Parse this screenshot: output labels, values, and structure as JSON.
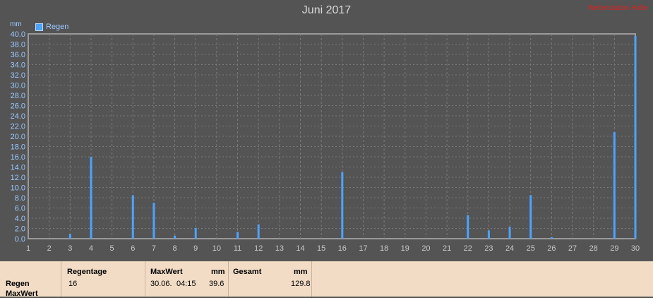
{
  "title": "Juni 2017",
  "watermark": "Wetterstation Halle",
  "legend": {
    "label": "Regen",
    "color": "#4da3ff"
  },
  "unit_label": "mm",
  "chart_data": {
    "type": "bar",
    "title": "Juni 2017",
    "ylabel": "mm",
    "xlabel": "",
    "x_ticks": [
      1,
      2,
      3,
      4,
      5,
      6,
      7,
      8,
      9,
      10,
      11,
      12,
      13,
      14,
      15,
      16,
      17,
      18,
      19,
      20,
      21,
      22,
      23,
      24,
      25,
      26,
      27,
      28,
      29,
      30
    ],
    "y_ticks": [
      "0.0",
      "2.0",
      "4.0",
      "6.0",
      "8.0",
      "10.0",
      "12.0",
      "14.0",
      "16.0",
      "18.0",
      "20.0",
      "22.0",
      "24.0",
      "26.0",
      "28.0",
      "30.0",
      "32.0",
      "34.0",
      "36.0",
      "38.0",
      "40.0"
    ],
    "ylim": [
      0,
      40
    ],
    "xlim": [
      1,
      30
    ],
    "grid": true,
    "series": [
      {
        "name": "Regen",
        "color": "#4da3ff",
        "points": [
          {
            "x": 3,
            "y": 0.9
          },
          {
            "x": 4,
            "y": 16.0
          },
          {
            "x": 6,
            "y": 8.5
          },
          {
            "x": 7,
            "y": 7.0
          },
          {
            "x": 8,
            "y": 0.6
          },
          {
            "x": 9,
            "y": 2.1
          },
          {
            "x": 11,
            "y": 1.3
          },
          {
            "x": 12,
            "y": 2.8
          },
          {
            "x": 16,
            "y": 13.0
          },
          {
            "x": 22,
            "y": 4.6
          },
          {
            "x": 23,
            "y": 1.6
          },
          {
            "x": 24,
            "y": 2.3
          },
          {
            "x": 25,
            "y": 8.5
          },
          {
            "x": 26,
            "y": 0.3
          },
          {
            "x": 29,
            "y": 20.8
          },
          {
            "x": 30,
            "y": 39.6
          }
        ]
      }
    ]
  },
  "stats": {
    "row_labels": [
      "Regen",
      "MaxWert"
    ],
    "regentage": {
      "header": "Regentage",
      "value": "16"
    },
    "maxwert": {
      "header": "MaxWert",
      "unit": "mm",
      "date": "30.06.",
      "time": "04:15",
      "value": "39.6"
    },
    "gesamt": {
      "header": "Gesamt",
      "unit": "mm",
      "value": "129.8"
    }
  }
}
